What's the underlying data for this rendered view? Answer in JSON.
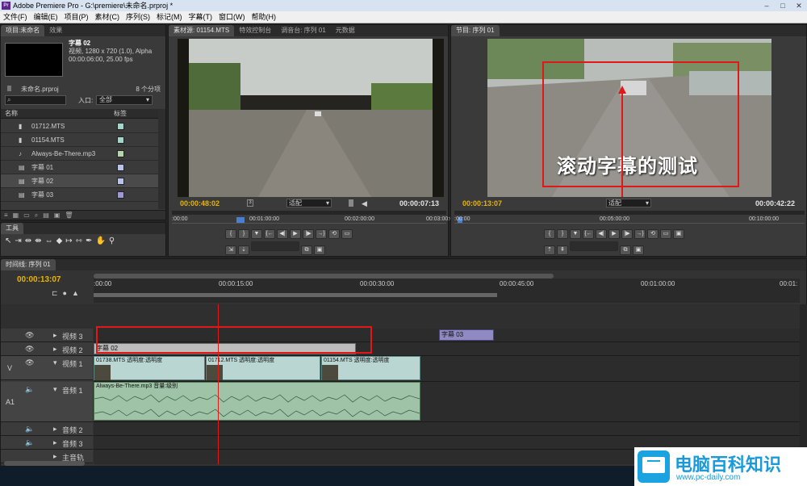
{
  "window": {
    "title": "Adobe Premiere Pro - G:\\premiere\\未命名.prproj *",
    "icon": "premiere-app-icon",
    "controls": [
      "–",
      "□",
      "✕"
    ]
  },
  "menu": [
    "文件(F)",
    "编辑(E)",
    "项目(P)",
    "素材(C)",
    "序列(S)",
    "标记(M)",
    "字幕(T)",
    "窗口(W)",
    "帮助(H)"
  ],
  "project": {
    "tabs": [
      "项目:未命名",
      "效果"
    ],
    "preview": {
      "name": "字幕 02",
      "line1": "视频, 1280 x 720 (1.0), Alpha",
      "line2": "00:00:06:00, 25.00 fps"
    },
    "project_file": "未命名.prproj",
    "item_count": "8 个分项",
    "in_label": "入口:",
    "in_value": "全部",
    "col_name": "名称",
    "col_label": "标签",
    "items": [
      {
        "name": "01712.MTS",
        "icon": "video-file-icon",
        "color": "#a8d3c8"
      },
      {
        "name": "01154.MTS",
        "icon": "video-file-icon",
        "color": "#a8d3c8"
      },
      {
        "name": "Always-Be-There.mp3",
        "icon": "audio-file-icon",
        "color": "#b8d3b0"
      },
      {
        "name": "字幕 01",
        "icon": "title-file-icon",
        "color": "#b9c3e6"
      },
      {
        "name": "字幕 02",
        "icon": "title-file-icon",
        "color": "#b9c3e6"
      },
      {
        "name": "字幕 03",
        "icon": "title-file-icon",
        "color": "#9e9ad1"
      }
    ]
  },
  "tools": {
    "label": "工具"
  },
  "source": {
    "tabs": [
      "素材源: 01154.MTS",
      "特效控制台",
      "调音台: 序列 01",
      "元数据"
    ],
    "tc_left": "00:00:48:02",
    "fit": "适配",
    "tc_right": "00:00:07:13",
    "ruler": [
      ":00:00",
      "00:01:00:00",
      "00:02:00:00",
      "00:03:00:00"
    ]
  },
  "program": {
    "tab": "节目: 序列 01",
    "tc_left": "00:00:13:07",
    "fit": "适配",
    "tc_right": "00:00:42:22",
    "ruler": [
      ":00:00",
      "00:05:00:00",
      "00:10:00:00"
    ],
    "overlay": "滚动字幕的测试"
  },
  "timeline": {
    "tab": "时间线: 序列 01",
    "tc": "00:00:13:07",
    "ruler": [
      ":00:00",
      "00:00:15:00",
      "00:00:30:00",
      "00:00:45:00",
      "00:01:00:00",
      "00:01:"
    ],
    "v_label": "V",
    "a_label": "A1",
    "tracks": [
      {
        "name": "视频 3"
      },
      {
        "name": "视频 2"
      },
      {
        "name": "视频 1"
      },
      {
        "name": "音频 1"
      },
      {
        "name": "音频 2"
      },
      {
        "name": "音频 3"
      },
      {
        "name": "主音轨"
      }
    ],
    "clips": {
      "title02": "字幕 02",
      "title03": "字幕 03",
      "v1": [
        "01738.MTS 透明度:透明度",
        "01712.MTS 透明度:透明度",
        "01154.MTS 透明度:透明度"
      ],
      "a1": "Always-Be-There.mp3 音量:级别"
    }
  },
  "watermark": {
    "title": "电脑百科知识",
    "url": "www.pc-daily.com"
  }
}
